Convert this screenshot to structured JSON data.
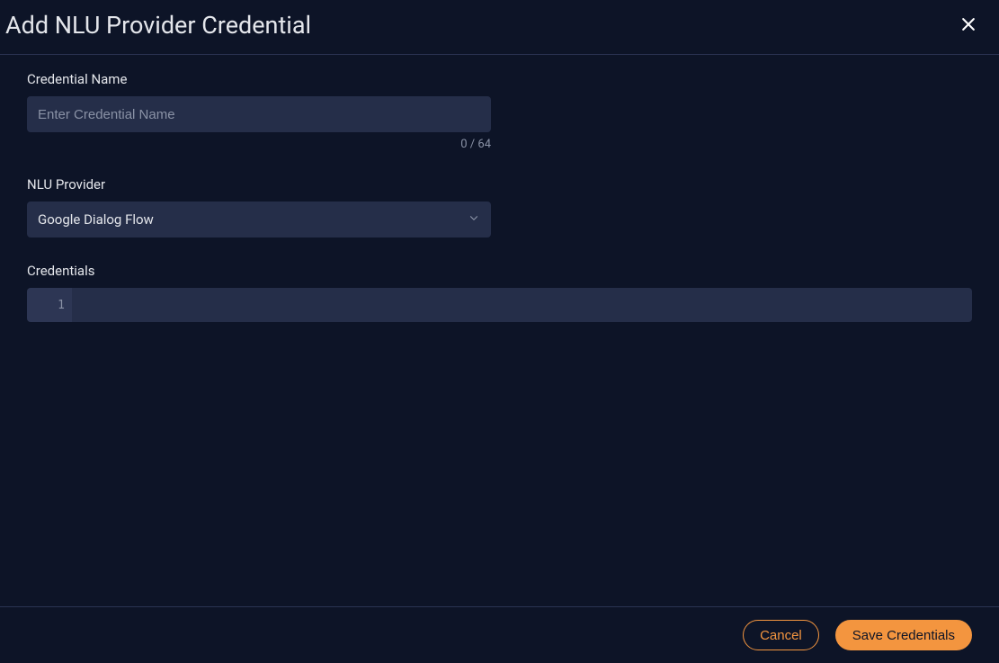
{
  "header": {
    "title": "Add NLU Provider Credential"
  },
  "form": {
    "credential_name": {
      "label": "Credential Name",
      "placeholder": "Enter Credential Name",
      "value": "",
      "counter": "0 / 64"
    },
    "nlu_provider": {
      "label": "NLU Provider",
      "selected": "Google Dialog Flow"
    },
    "credentials": {
      "label": "Credentials",
      "line_number": "1",
      "value": ""
    }
  },
  "footer": {
    "cancel": "Cancel",
    "save": "Save Credentials"
  }
}
